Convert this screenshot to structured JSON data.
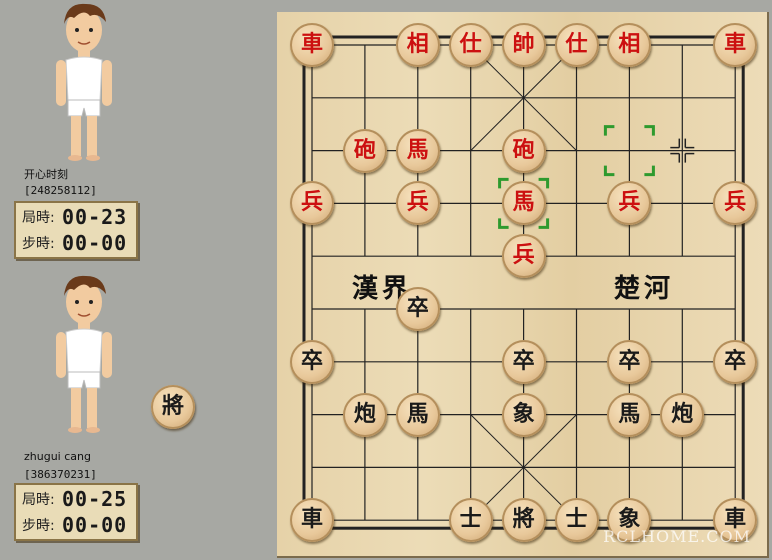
{
  "players": [
    {
      "name": "开心时刻",
      "id": "[248258112]",
      "timer_label_game": "局時:",
      "timer_game": "00-23",
      "timer_label_step": "步時:",
      "timer_step": "00-00"
    },
    {
      "name": "zhugui cang",
      "id": "[386370231]",
      "timer_label_game": "局時:",
      "timer_game": "00-25",
      "timer_label_step": "步時:",
      "timer_step": "00-00"
    }
  ],
  "captured_piece": {
    "label": "將",
    "side": "black"
  },
  "board": {
    "river_left": "漢界",
    "river_right": "楚河",
    "colors": {
      "red": "#cc1010",
      "black": "#1a1a1a",
      "highlight": "#2e9a2e"
    },
    "selection": [
      {
        "col": 4,
        "row": 3
      },
      {
        "col": 6,
        "row": 2
      }
    ],
    "pieces": [
      {
        "label": "車",
        "side": "red",
        "col": 0,
        "row": 0
      },
      {
        "label": "相",
        "side": "red",
        "col": 2,
        "row": 0
      },
      {
        "label": "仕",
        "side": "red",
        "col": 3,
        "row": 0
      },
      {
        "label": "帥",
        "side": "red",
        "col": 4,
        "row": 0
      },
      {
        "label": "仕",
        "side": "red",
        "col": 5,
        "row": 0
      },
      {
        "label": "相",
        "side": "red",
        "col": 6,
        "row": 0
      },
      {
        "label": "車",
        "side": "red",
        "col": 8,
        "row": 0
      },
      {
        "label": "砲",
        "side": "red",
        "col": 1,
        "row": 2
      },
      {
        "label": "馬",
        "side": "red",
        "col": 2,
        "row": 2
      },
      {
        "label": "砲",
        "side": "red",
        "col": 4,
        "row": 2
      },
      {
        "label": "兵",
        "side": "red",
        "col": 0,
        "row": 3
      },
      {
        "label": "兵",
        "side": "red",
        "col": 2,
        "row": 3
      },
      {
        "label": "馬",
        "side": "red",
        "col": 4,
        "row": 3
      },
      {
        "label": "兵",
        "side": "red",
        "col": 6,
        "row": 3
      },
      {
        "label": "兵",
        "side": "red",
        "col": 8,
        "row": 3
      },
      {
        "label": "兵",
        "side": "red",
        "col": 4,
        "row": 4
      },
      {
        "label": "卒",
        "side": "black",
        "col": 2,
        "row": 5
      },
      {
        "label": "卒",
        "side": "black",
        "col": 0,
        "row": 6
      },
      {
        "label": "卒",
        "side": "black",
        "col": 4,
        "row": 6
      },
      {
        "label": "卒",
        "side": "black",
        "col": 6,
        "row": 6
      },
      {
        "label": "卒",
        "side": "black",
        "col": 8,
        "row": 6
      },
      {
        "label": "炮",
        "side": "black",
        "col": 1,
        "row": 7
      },
      {
        "label": "馬",
        "side": "black",
        "col": 2,
        "row": 7
      },
      {
        "label": "象",
        "side": "black",
        "col": 4,
        "row": 7
      },
      {
        "label": "馬",
        "side": "black",
        "col": 6,
        "row": 7
      },
      {
        "label": "炮",
        "side": "black",
        "col": 7,
        "row": 7
      },
      {
        "label": "車",
        "side": "black",
        "col": 0,
        "row": 9
      },
      {
        "label": "士",
        "side": "black",
        "col": 3,
        "row": 9
      },
      {
        "label": "將",
        "side": "black",
        "col": 4,
        "row": 9
      },
      {
        "label": "士",
        "side": "black",
        "col": 5,
        "row": 9
      },
      {
        "label": "象",
        "side": "black",
        "col": 6,
        "row": 9
      },
      {
        "label": "車",
        "side": "black",
        "col": 8,
        "row": 9
      }
    ]
  },
  "watermark": "RCLHOME.COM"
}
